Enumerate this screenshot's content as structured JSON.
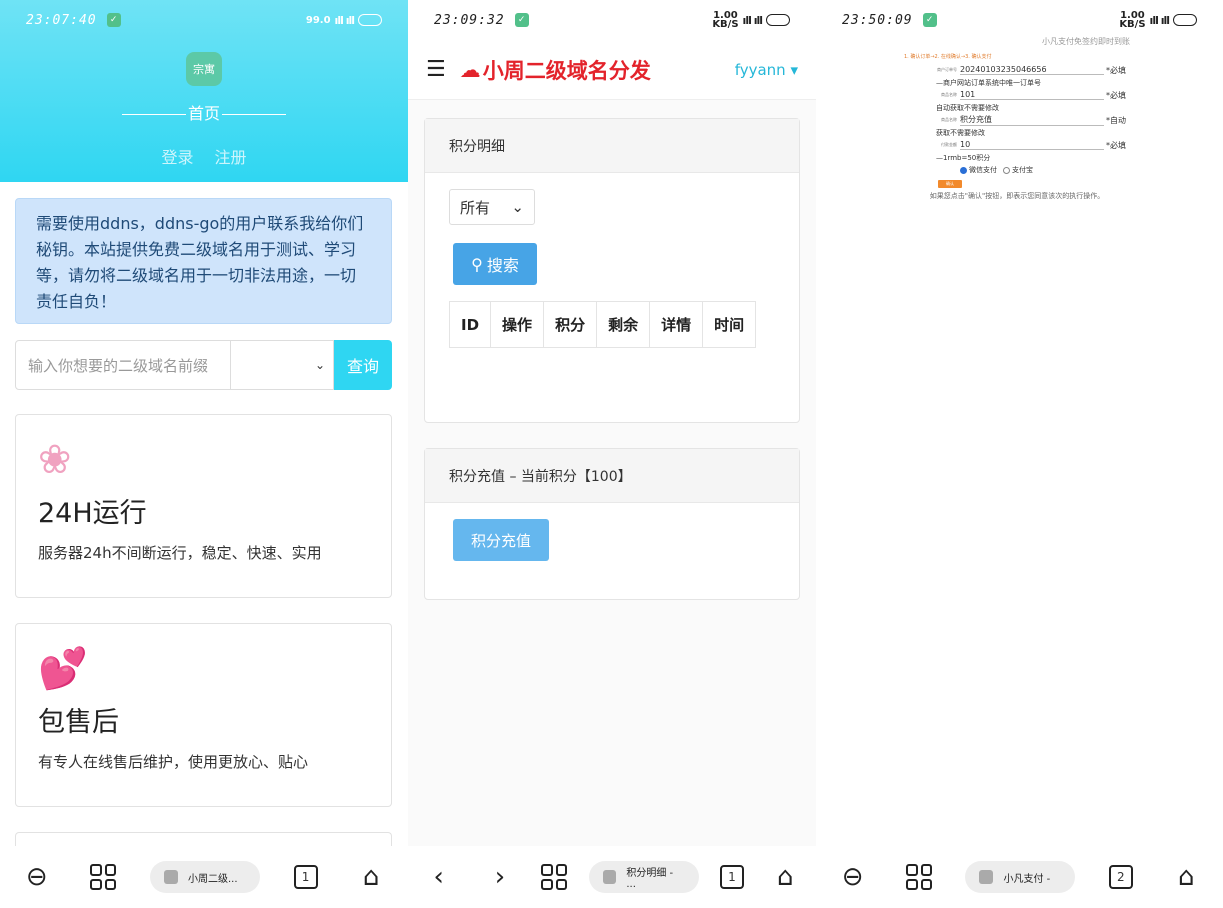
{
  "panel1": {
    "status": {
      "time": "23:07:40",
      "net": "99.0",
      "batt": ""
    },
    "hero": {
      "logo": "宗寓",
      "title": "首页",
      "login": "登录",
      "register": "注册"
    },
    "notice": "需要使用ddns，ddns-go的用户联系我给你们秘钥。本站提供免费二级域名用于测试、学习等，请勿将二级域名用于一切非法用途，一切责任自负！",
    "query": {
      "placeholder": "输入你想要的二级域名前缀",
      "button": "查询"
    },
    "cards": [
      {
        "icon": "cherry-blossom-icon",
        "title": "24H运行",
        "desc": "服务器24h不间断运行，稳定、快速、实用"
      },
      {
        "icon": "hearts-icon",
        "title": "包售后",
        "desc": "有专人在线售后维护，使用更放心、贴心"
      }
    ],
    "tab": "小周二级..."
  },
  "panel2": {
    "status": {
      "time": "23:09:32",
      "net": "1.00\nKB/S"
    },
    "brand": "小周二级域名分发",
    "user": "fyyann",
    "points_box": {
      "title": "积分明细",
      "filter": "所有",
      "search": "搜索",
      "columns": [
        "ID",
        "操作",
        "积分",
        "剩余",
        "详情",
        "时间"
      ]
    },
    "recharge_box": {
      "title": "积分充值 – 当前积分【100】",
      "button": "积分充值"
    },
    "tab": "积分明细 - ..."
  },
  "panel3": {
    "status": {
      "time": "23:50:09",
      "net": "1.00\nKB/S"
    },
    "top_note": "小凡支付免签约即时到账",
    "steps": "1. 确认订单→2. 在线确认→3. 确认支付",
    "fields": [
      {
        "label": "商户订单号",
        "value": "20240103235046656",
        "req": "*必填"
      },
      {
        "label": "商品名称",
        "value": "101",
        "req": "*必填"
      },
      {
        "label": "商品名称",
        "value": "积分充值",
        "req": "*自动"
      },
      {
        "label": "付款金额",
        "value": "10",
        "req": "*必填"
      }
    ],
    "tips": [
      "—商户网站订单系统中唯一订单号",
      "自动获取不需要修改",
      "获取不需要修改",
      "—1rmb=50积分"
    ],
    "pay_methods": [
      "微信支付",
      "支付宝"
    ],
    "pay_button": "确认",
    "confirm_note": "如果您点击\"确认\"按钮，即表示您同意该次的执行操作。",
    "tab": "小凡支付 -"
  }
}
